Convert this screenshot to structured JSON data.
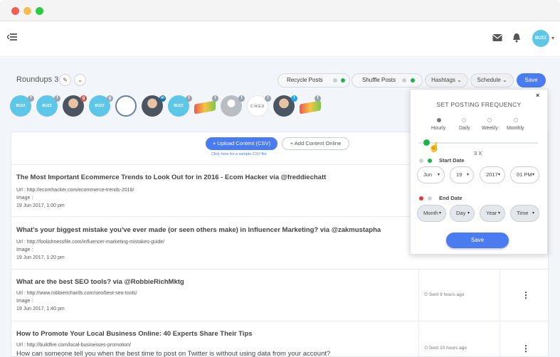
{
  "header": {
    "avatar_text": "BUZZ",
    "icons": [
      "mail-icon",
      "bell-icon",
      "menu-toggle-icon"
    ]
  },
  "toolbar": {
    "title": "Roundups 3",
    "recycle_label": "Recycle Posts",
    "shuffle_label": "Shuffle Posts",
    "hashtags_label": "Hashtags",
    "schedule_label": "Schedule",
    "save_label": "Save"
  },
  "profiles": {
    "buzz_label": "BUZZ",
    "ciked_label": "CIKED"
  },
  "upload": {
    "upload_label": "+ Upload Content (CSV)",
    "add_label": "+ Add Content Online",
    "csv_link": "Click here for a sample CSV file"
  },
  "rows": [
    {
      "title": "The Most Important Ecommerce Trends to Look Out for in 2016 - Ecom Hacker via @freddiechatt",
      "url": "Url : http://ecomhacker.com/ecommerce-trends-2016/",
      "image": "Image :",
      "date": "19 Jun 2017, 1:00 pm"
    },
    {
      "title": "What's your biggest mistake you've ever made (or seen others make) in Influencer Marketing? via @zakmustapha",
      "url": "Url : http://foolishnessfile.com/influencer-marketing-mistakes-guide/",
      "image": "Image :",
      "date": "19 Jun 2017, 1:20 pm"
    },
    {
      "title": "What are the best SEO tools? via @RobbieRichMktg",
      "url": "Url : http://www.robbierichards.com/seo/best-seo-tools/",
      "image": "Image :",
      "date": "19 Jun 2017, 1:40 pm",
      "sent": "Sent 9 hours ago"
    },
    {
      "title": "How to Promote Your Local Business Online: 40 Experts Share Their Tips",
      "url": "Url : http://buildfire.com/local-businesses-promotion/",
      "extra": "How can someone tell you when the best time to post on Twitter is without using data from your account?",
      "sent": "Sent 10 hours ago"
    }
  ],
  "popup": {
    "title": "SET POSTING FREQUENCY",
    "options": [
      "Hourly",
      "Daily",
      "Weekly",
      "Monthly"
    ],
    "selected": "Hourly",
    "frequency_value": "3 X",
    "start_label": "Start Date",
    "start": {
      "month": "Jun",
      "day": "19",
      "year": "2017",
      "time": "01 PM"
    },
    "end_label": "End Date",
    "end": {
      "month": "Month",
      "day": "Day",
      "year": "Year",
      "time": "Time"
    },
    "save_label": "Save"
  },
  "colors": {
    "primary": "#4a7bf0",
    "toggle_on": "#1fb14b",
    "toggle_off_red": "#e53935",
    "profile_blue": "#5ec6e6"
  }
}
